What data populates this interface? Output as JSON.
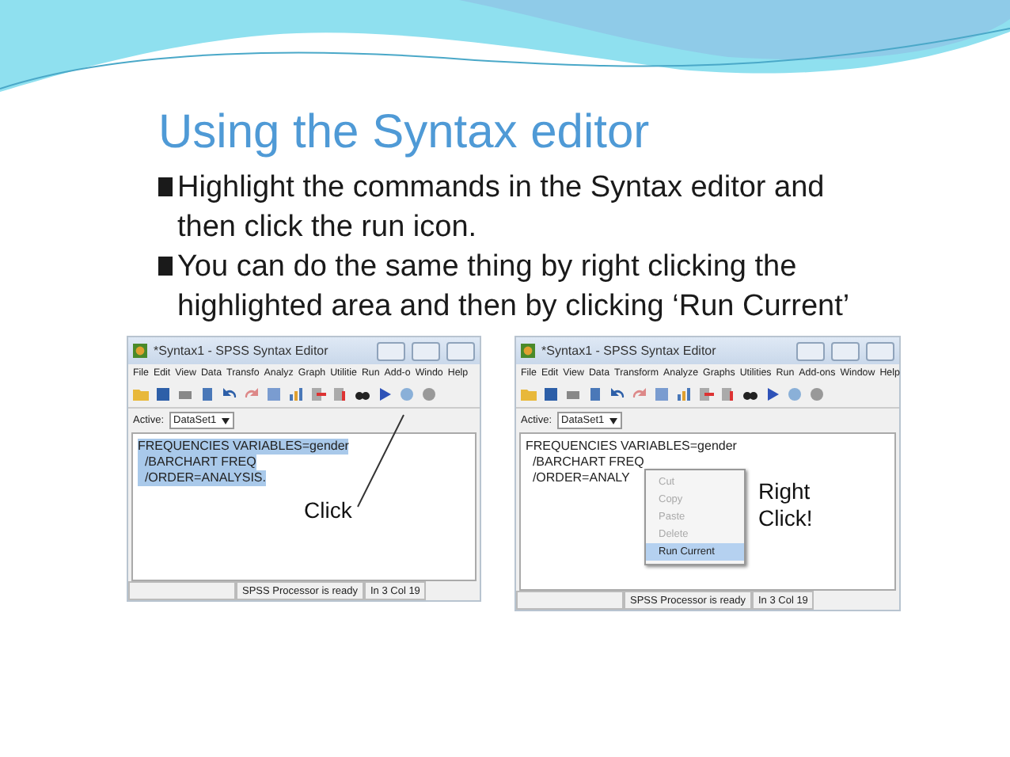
{
  "title": "Using the Syntax editor",
  "bullets": [
    "Highlight the commands in the Syntax editor and then click the run icon.",
    "You can do the same thing by right clicking the highlighted area and then by clicking ‘Run Current’"
  ],
  "screenshots": [
    {
      "window_title": "*Syntax1 - SPSS Syntax Editor",
      "menu": [
        "File",
        "Edit",
        "View",
        "Data",
        "Transfo",
        "Analyz",
        "Graph",
        "Utilitie",
        "Run",
        "Add-o",
        "Windo",
        "Help"
      ],
      "active_label": "Active:",
      "dataset": "DataSet1",
      "code_lines": [
        "FREQUENCIES VARIABLES=gender",
        "  /BARCHART FREQ",
        "  /ORDER=ANALYSIS."
      ],
      "code_selected": true,
      "status": "SPSS  Processor is ready",
      "position": "In 3 Col 19",
      "callout": "Click",
      "arrow": true
    },
    {
      "window_title": "*Syntax1 - SPSS Syntax Editor",
      "menu": [
        "File",
        "Edit",
        "View",
        "Data",
        "Transform",
        "Analyze",
        "Graphs",
        "Utilities",
        "Run",
        "Add-ons",
        "Window",
        "Help"
      ],
      "active_label": "Active:",
      "dataset": "DataSet1",
      "code_lines": [
        "FREQUENCIES VARIABLES=gender",
        "  /BARCHART FREQ",
        "  /ORDER=ANALY"
      ],
      "code_selected": false,
      "status": "SPSS  Processor is ready",
      "position": "In 3 Col 19",
      "callout": "Right Click!",
      "arrow": false,
      "context_menu": [
        {
          "label": "Cut",
          "disabled": true,
          "selected": false
        },
        {
          "label": "Copy",
          "disabled": true,
          "selected": false
        },
        {
          "label": "Paste",
          "disabled": true,
          "selected": false
        },
        {
          "label": "Delete",
          "disabled": true,
          "selected": false
        },
        {
          "label": "Run Current",
          "disabled": false,
          "selected": true
        }
      ]
    }
  ]
}
